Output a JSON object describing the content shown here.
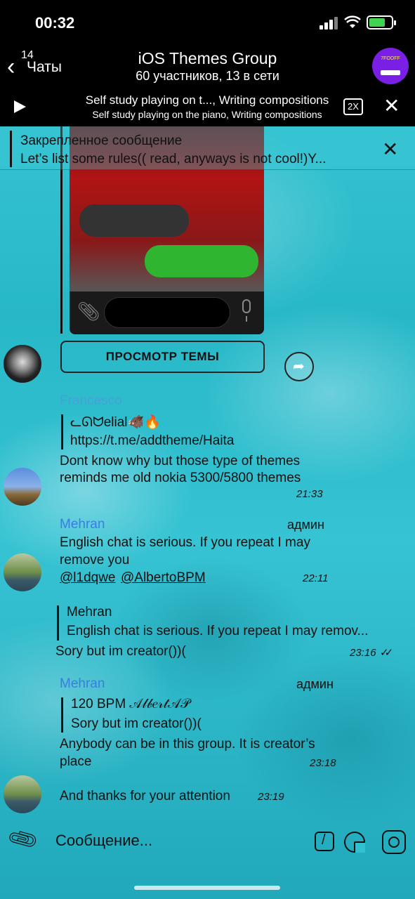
{
  "status": {
    "time": "00:32"
  },
  "nav": {
    "back_count": "14",
    "back_label": "Чаты",
    "title": "iOS Themes Group",
    "subtitle": "60 участников, 13 в сети",
    "avatar_text": "7FOOFF"
  },
  "player": {
    "title": "Self study playing on t..., Writing compositions",
    "subtitle": "Self study playing on the piano, Writing compositions",
    "speed": "2X"
  },
  "pinned": {
    "title": "Закрепленное сообщение",
    "text": "Let’s list some rules(( read, anyways is not cool!)Y..."
  },
  "theme": {
    "button_label": "ПРОСМОТР ТЕМЫ"
  },
  "messages": [
    {
      "sender": "Francesco",
      "reply_author": "ᓚᘏᗢelial🐗🔥",
      "reply_text": "https://t.me/addtheme/Haita",
      "text_line1": "Dont know why but those type of themes",
      "text_line2": "reminds me old nokia 5300/5800 themes",
      "time": "21:33"
    },
    {
      "sender": "Mehran",
      "role": "админ",
      "text_line1": "English chat is serious. If you repeat I may",
      "text_line2": "remove you",
      "mention1": "@l1dqwe",
      "mention2": "@AlbertoBPM",
      "time": "22:11"
    },
    {
      "reply_author": "Mehran",
      "reply_text": "English chat is serious. If you repeat I may remov...",
      "text": "Sory but im creator())(",
      "time": "23:16",
      "status": "✓✓"
    },
    {
      "sender": "Mehran",
      "role": "админ",
      "reply_author": "120 BPM 𝒜𝓁𝒷𝑒𝓇𝓉𝒜𝒫",
      "reply_text": "Sory but im creator())(",
      "text_line1": "Anybody can be in this group. It is creator’s",
      "text_line2": "place",
      "time": "23:18"
    },
    {
      "text": "And thanks for your attention",
      "time": "23:19"
    }
  ],
  "composer": {
    "placeholder": "Сообщение..."
  }
}
